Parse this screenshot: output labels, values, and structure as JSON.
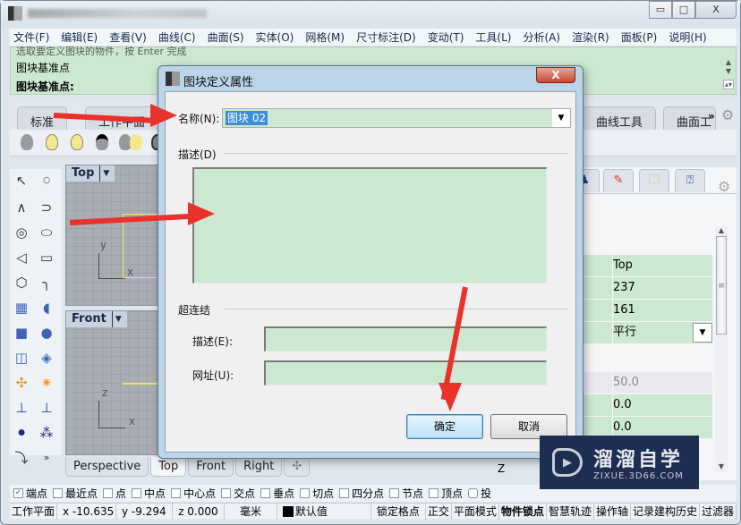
{
  "window": {
    "controls": {
      "minimize": "▭",
      "maximize": "□",
      "close": "X"
    }
  },
  "menu": [
    "文件(F)",
    "编辑(E)",
    "查看(V)",
    "曲线(C)",
    "曲面(S)",
    "实体(O)",
    "网格(M)",
    "尺寸标注(D)",
    "变动(T)",
    "工具(L)",
    "分析(A)",
    "渲染(R)",
    "面板(P)",
    "说明(H)"
  ],
  "command": {
    "history_partial": "选取要定义图块的物件，按 Enter 完成",
    "history_line": "图块基准点",
    "prompt": "图块基准点:"
  },
  "toolbar_tabs": [
    "标准",
    "工作平面",
    "曲线工具",
    "曲面工"
  ],
  "toolbar_tabs_more": "»",
  "viewports": {
    "top": {
      "label": "Top",
      "axis_x": "x",
      "axis_y": "y"
    },
    "front": {
      "label": "Front",
      "axis_x": "x",
      "axis_y": "z"
    }
  },
  "viewport_tabs": [
    "Perspective",
    "Top",
    "Front",
    "Right"
  ],
  "viewport_tab_add": "✣",
  "active_viewport_tab": "Top",
  "properties": {
    "rows": [
      {
        "value": "Top"
      },
      {
        "value": "237"
      },
      {
        "value": "161"
      },
      {
        "value": "平行",
        "dropdown": true
      },
      {
        "value": "50.0",
        "disabled": true
      },
      {
        "value": "0.0"
      },
      {
        "value": "0.0"
      }
    ],
    "partial_label": "Z"
  },
  "osnap": [
    {
      "label": "端点",
      "checked": true
    },
    {
      "label": "最近点",
      "checked": false
    },
    {
      "label": "点",
      "checked": false
    },
    {
      "label": "中点",
      "checked": false
    },
    {
      "label": "中心点",
      "checked": false
    },
    {
      "label": "交点",
      "checked": false
    },
    {
      "label": "垂点",
      "checked": false
    },
    {
      "label": "切点",
      "checked": false
    },
    {
      "label": "四分点",
      "checked": false
    },
    {
      "label": "节点",
      "checked": false
    },
    {
      "label": "顶点",
      "checked": false
    },
    {
      "label": "投",
      "checked": false
    }
  ],
  "status": {
    "cplane": "工作平面",
    "x": "x -10.635",
    "y": "y -9.294",
    "z": "z 0.000",
    "units": "毫米",
    "layer": "默认值",
    "grid_snap": "锁定格点",
    "ortho": "正交",
    "planar": "平面模式",
    "osnap": "物件锁点",
    "smarttrack": "智慧轨迹",
    "gumball": "操作轴",
    "history": "记录建构历史",
    "filter": "过滤器"
  },
  "dialog": {
    "title": "图块定义属性",
    "name_label": "名称(N):",
    "name_value": "图块 02",
    "description_label": "描述(D)",
    "hyperlink_label": "超连结",
    "link_desc_label": "描述(E):",
    "url_label": "网址(U):",
    "ok": "确定",
    "cancel": "取消",
    "close": "X"
  },
  "watermark": {
    "cn": "溜溜自学",
    "en": "ZIXUE.3D66.COM"
  }
}
